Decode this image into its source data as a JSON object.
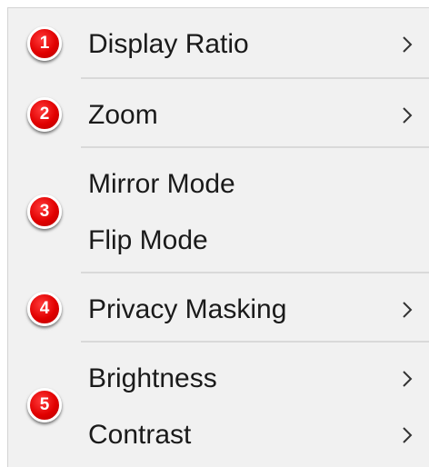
{
  "menu": {
    "items": [
      {
        "label": "Display Ratio",
        "has_submenu": true
      },
      {
        "label": "Zoom",
        "has_submenu": true
      },
      {
        "label": "Mirror Mode",
        "has_submenu": false
      },
      {
        "label": "Flip Mode",
        "has_submenu": false
      },
      {
        "label": "Privacy Masking",
        "has_submenu": true
      },
      {
        "label": "Brightness",
        "has_submenu": true
      },
      {
        "label": "Contrast",
        "has_submenu": true
      }
    ],
    "arrow_icon": "chevron-right-icon"
  },
  "badges": [
    "1",
    "2",
    "3",
    "4",
    "5"
  ],
  "colors": {
    "badge": "#e10000",
    "menu_background": "#f1f1f1",
    "text": "#1a1a1a",
    "separator": "#d9d9d9"
  }
}
